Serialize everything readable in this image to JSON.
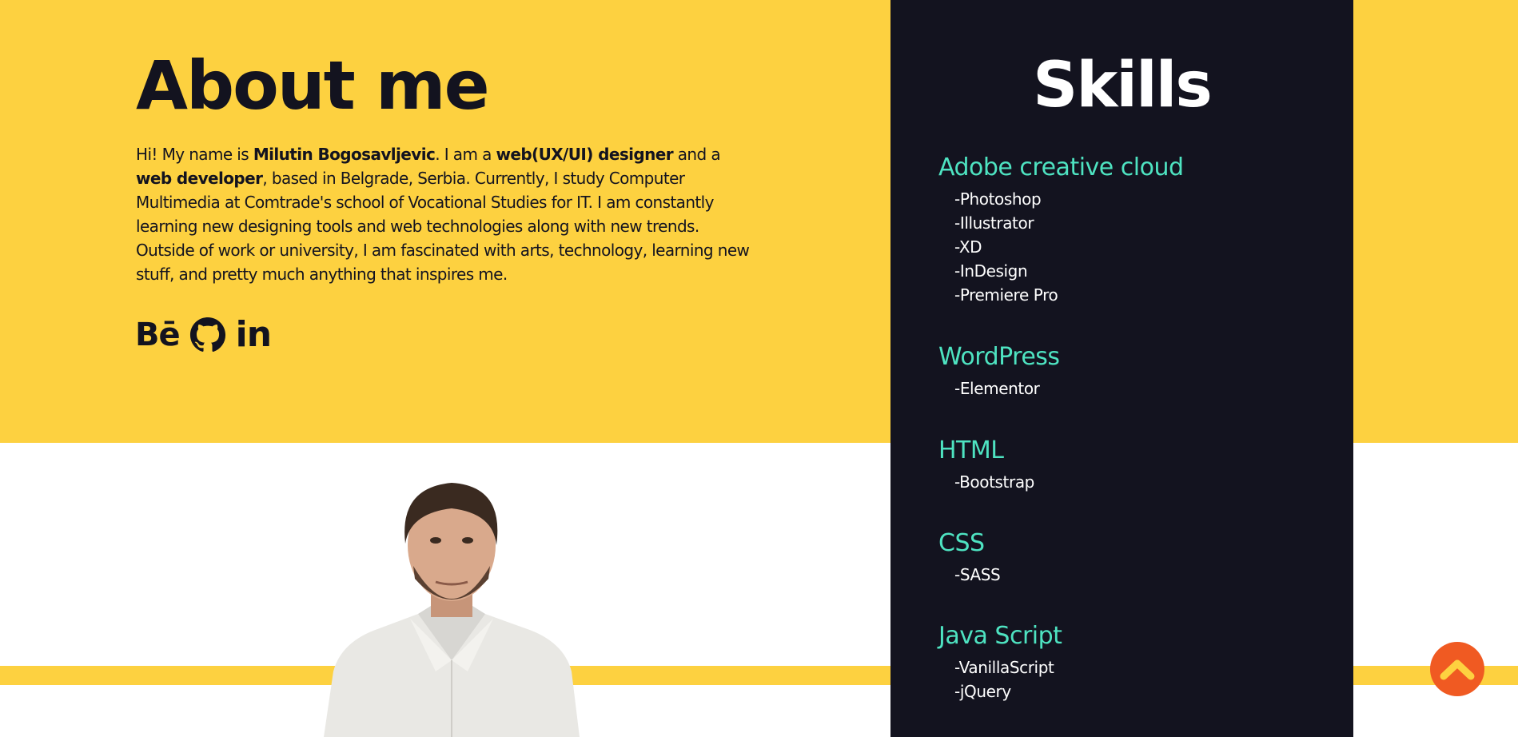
{
  "about": {
    "title": "About me",
    "paragraph": [
      {
        "text": "Hi! My name is ",
        "bold": false
      },
      {
        "text": "Milutin Bogosavljevic",
        "bold": true
      },
      {
        "text": ". I am a ",
        "bold": false
      },
      {
        "text": "web(UX/UI) designer",
        "bold": true
      },
      {
        "text": " and a ",
        "bold": false
      },
      {
        "text": "web developer",
        "bold": true
      },
      {
        "text": ", based in Belgrade, Serbia. Currently, I study Computer Multimedia at Comtrade's school of Vocational Studies for IT. I am constantly learning new designing tools and web technologies along with new trends. Outside of work or university, I am fascinated with arts, technology, learning new stuff, and pretty much anything that inspires me.",
        "bold": false
      }
    ],
    "socials": {
      "behance": "Bē",
      "github_icon": "github-icon",
      "linkedin": "in"
    }
  },
  "skills": {
    "title": "Skills",
    "groups": [
      {
        "name": "Adobe creative cloud",
        "items": [
          "-Photoshop",
          "-Illustrator",
          "-XD",
          "-InDesign",
          "-Premiere Pro"
        ]
      },
      {
        "name": "WordPress",
        "items": [
          "-Elementor"
        ]
      },
      {
        "name": "HTML",
        "items": [
          "-Bootstrap"
        ]
      },
      {
        "name": "CSS",
        "items": [
          "-SASS"
        ]
      },
      {
        "name": "Java Script",
        "items": [
          "-VanillaScript",
          "-jQuery"
        ]
      }
    ]
  },
  "scroll_top": {
    "icon": "chevron-up-icon"
  },
  "colors": {
    "yellow": "#fdd140",
    "dark": "#13131f",
    "accent": "#4ee3c1",
    "orange": "#f05a22",
    "white": "#ffffff"
  }
}
